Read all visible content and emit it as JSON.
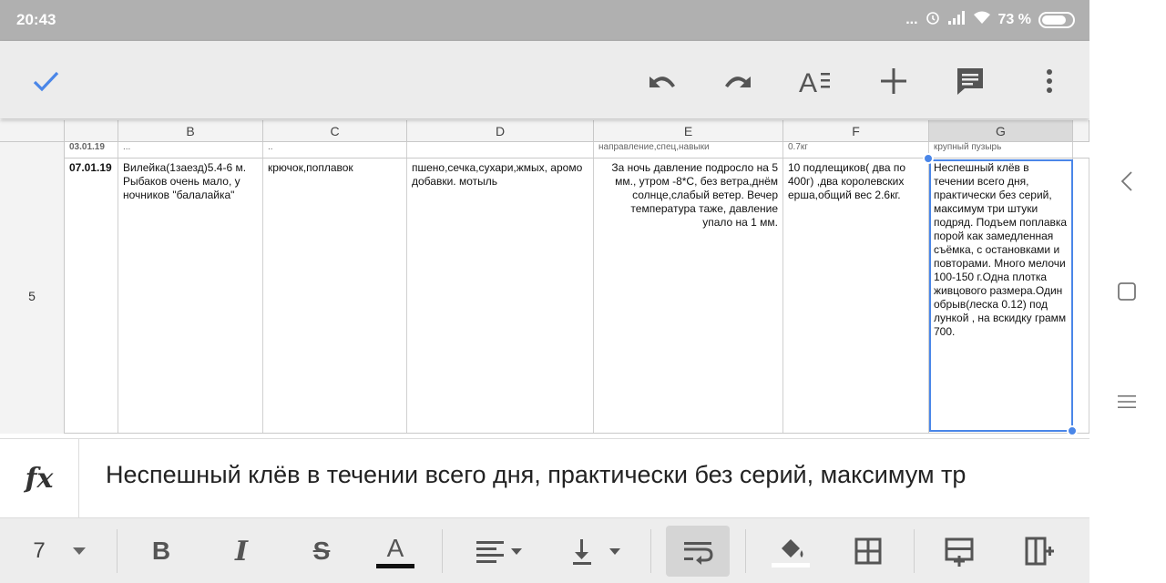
{
  "status": {
    "time": "20:43",
    "dots": "...",
    "battery": "73 %",
    "battery_level": 0.73
  },
  "toolbar": {
    "confirm_icon": "checkmark-icon",
    "undo_icon": "undo-icon",
    "redo_icon": "redo-icon",
    "format_icon": "text-format-icon",
    "insert_icon": "plus-icon",
    "comment_icon": "comment-icon",
    "more_icon": "more-vert-icon"
  },
  "sheet": {
    "columns": [
      "B",
      "C",
      "D",
      "E",
      "F",
      "G"
    ],
    "selected_column": "G",
    "row_above": {
      "a": "03.01.19",
      "b": "...",
      "c": "..",
      "e": "направление,спец,навыки",
      "f": "0.7кг",
      "g": "крупный пузырь"
    },
    "row": {
      "number": "5",
      "a": "07.01.19",
      "b": "Вилейка(1заезд)5.4-6 м. Рыбаков очень мало, у ночников \"балалайка\"",
      "c": "крючок,поплавок",
      "d": "пшено,сечка,сухари,жмых, аромо добавки.  мотыль",
      "e": "За ночь давление подросло на 5 мм., утром -8*С, без ветра,днём солнце,слабый ветер. Вечер температура таже, давление упало на 1 мм.",
      "f": "10 подлещиков( два по 400г) ,два королевских ерша,общий вес 2.6кг.",
      "g": "Неспешный клёв в течении всего дня, практически без серий, максимум три штуки подряд. Подъем поплавка порой  как замедленная съёмка, с остановками и повторами. Много мелочи 100-150 г.Одна плотка живцового размера.Один обрыв(леска 0.12) под лункой , на вскидку грамм 700."
    }
  },
  "formula": {
    "icon": "fx",
    "value": "Неспешный клёв в течении всего дня, практически без серий, максимум тр"
  },
  "formatbar": {
    "font_size": "7",
    "bold": "B",
    "italic": "I",
    "strike": "S",
    "text_color": "A",
    "accent": "#4a86e8"
  }
}
